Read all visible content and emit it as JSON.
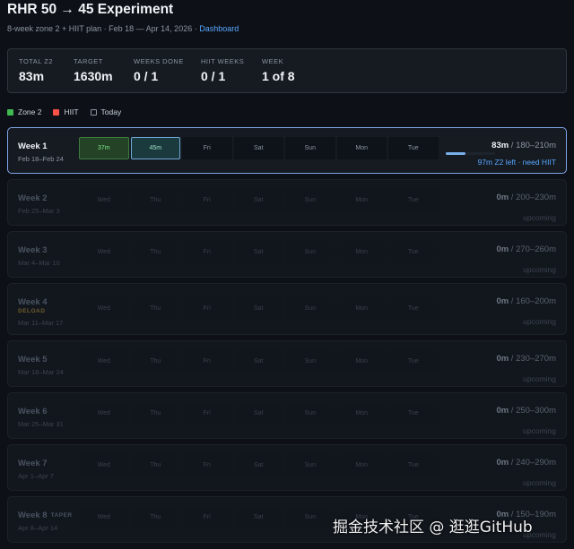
{
  "header": {
    "title": "RHR 50 → 45 Experiment",
    "subtitle": "8-week zone 2 + HIIT plan · Feb 18 — Apr 14, 2026 · ",
    "link": "Dashboard"
  },
  "stats": [
    {
      "label": "TOTAL Z2",
      "value": "83m"
    },
    {
      "label": "TARGET",
      "value": "1630m"
    },
    {
      "label": "WEEKS DONE",
      "value": "0 / 1"
    },
    {
      "label": "HIIT WEEKS",
      "value": "0 / 1"
    },
    {
      "label": "WEEK",
      "value": "1 of 8"
    }
  ],
  "legend": [
    {
      "label": "Zone 2",
      "color": "#3fb950"
    },
    {
      "label": "HIIT",
      "color": "#f85149"
    },
    {
      "label": "Today",
      "color": "outline"
    }
  ],
  "weeks": [
    {
      "name": "Week 1",
      "dates": "Feb 18–Feb 24",
      "days": [
        "37m",
        "45m",
        "Fri",
        "Sat",
        "Sun",
        "Mon",
        "Tue"
      ],
      "total": "83m",
      "target": " / 180–210m",
      "status": "97m Z2 left · need HIIT",
      "progress": 0.4
    },
    {
      "name": "Week 2",
      "dates": "Feb 25–Mar 3",
      "days": [
        "Wed",
        "Thu",
        "Fri",
        "Sat",
        "Sun",
        "Mon",
        "Tue"
      ],
      "total": "0m",
      "target": " / 200–230m",
      "status": "upcoming"
    },
    {
      "name": "Week 3",
      "dates": "Mar 4–Mar 10",
      "days": [
        "Wed",
        "Thu",
        "Fri",
        "Sat",
        "Sun",
        "Mon",
        "Tue"
      ],
      "total": "0m",
      "target": " / 270–260m",
      "status": "upcoming"
    },
    {
      "name": "Week 4",
      "tag": "DELOAD",
      "dates": "Mar 11–Mar 17",
      "days": [
        "Wed",
        "Thu",
        "Fri",
        "Sat",
        "Sun",
        "Mon",
        "Tue"
      ],
      "total": "0m",
      "target": " / 160–200m",
      "status": "upcoming"
    },
    {
      "name": "Week 5",
      "dates": "Mar 18–Mar 24",
      "days": [
        "Wed",
        "Thu",
        "Fri",
        "Sat",
        "Sun",
        "Mon",
        "Tue"
      ],
      "total": "0m",
      "target": " / 230–270m",
      "status": "upcoming"
    },
    {
      "name": "Week 6",
      "dates": "Mar 25–Mar 31",
      "days": [
        "Wed",
        "Thu",
        "Fri",
        "Sat",
        "Sun",
        "Mon",
        "Tue"
      ],
      "total": "0m",
      "target": " / 250–300m",
      "status": "upcoming"
    },
    {
      "name": "Week 7",
      "dates": "Apr 1–Apr 7",
      "days": [
        "Wed",
        "Thu",
        "Fri",
        "Sat",
        "Sun",
        "Mon",
        "Tue"
      ],
      "total": "0m",
      "target": " / 240–290m",
      "status": "upcoming"
    },
    {
      "name": "Week 8",
      "tag": "TAPER",
      "dates": "Apr 8–Apr 14",
      "days": [
        "Wed",
        "Thu",
        "Fri",
        "Sat",
        "Sun",
        "Mon",
        "Tue"
      ],
      "total": "0m",
      "target": " / 150–190m",
      "status": "upcoming"
    }
  ],
  "watermark": "掘金技术社区 @ 逛逛GitHub"
}
